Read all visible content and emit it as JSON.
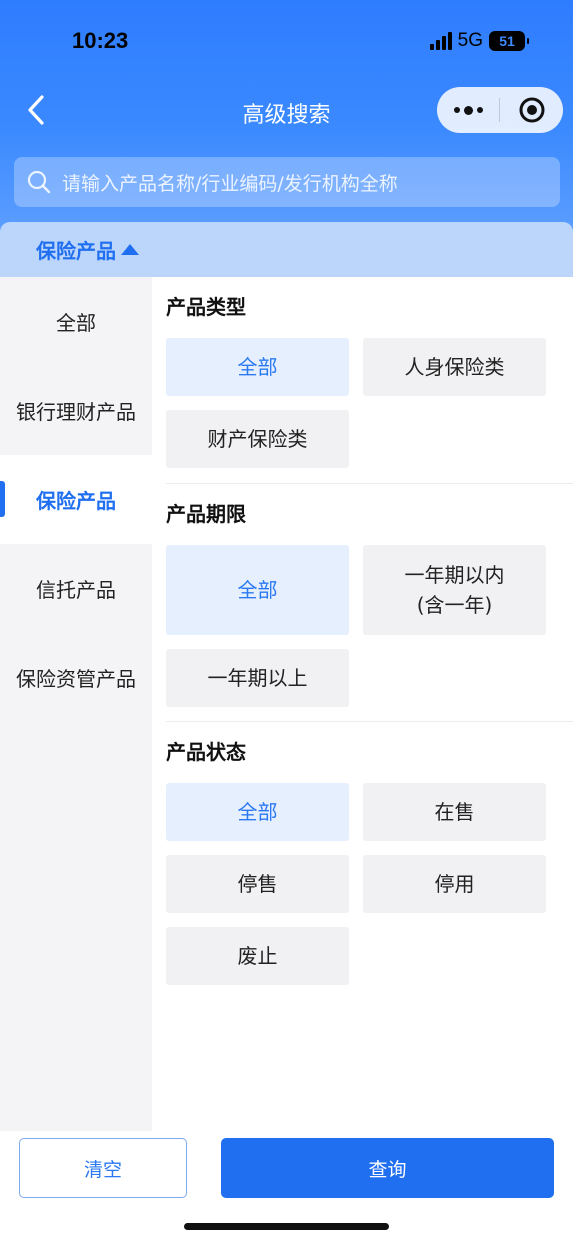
{
  "status_bar": {
    "time": "10:23",
    "network": "5G",
    "battery": "51"
  },
  "nav": {
    "title": "高级搜索",
    "back_icon": "chevron-left-icon",
    "more_icon": "more-dots-icon",
    "target_icon": "target-circle-icon"
  },
  "search": {
    "placeholder": "请输入产品名称/行业编码/发行机构全称",
    "icon": "search-icon"
  },
  "category_bar": {
    "label": "保险产品",
    "icon": "triangle-up-icon"
  },
  "sidebar": {
    "items": [
      {
        "label": "全部"
      },
      {
        "label": "银行理财产品"
      },
      {
        "label": "保险产品"
      },
      {
        "label": "信托产品"
      },
      {
        "label": "保险资管产品"
      }
    ],
    "active_index": 2
  },
  "filters": {
    "product_type": {
      "title": "产品类型",
      "options": [
        {
          "label": "全部"
        },
        {
          "label": "人身保险类"
        },
        {
          "label": "财产保险类"
        }
      ]
    },
    "product_term": {
      "title": "产品期限",
      "options": [
        {
          "label": "全部"
        },
        {
          "label_line1": "一年期以内",
          "label_line2": "(含一年)"
        },
        {
          "label": "一年期以上"
        }
      ]
    },
    "product_status": {
      "title": "产品状态",
      "options": [
        {
          "label": "全部"
        },
        {
          "label": "在售"
        },
        {
          "label": "停售"
        },
        {
          "label": "停用"
        },
        {
          "label": "废止"
        }
      ]
    }
  },
  "actions": {
    "clear_label": "清空",
    "query_label": "查询"
  },
  "colors": {
    "accent": "#1f6ff0",
    "selected_bg": "#e6effd",
    "option_bg": "#f1f1f3"
  }
}
